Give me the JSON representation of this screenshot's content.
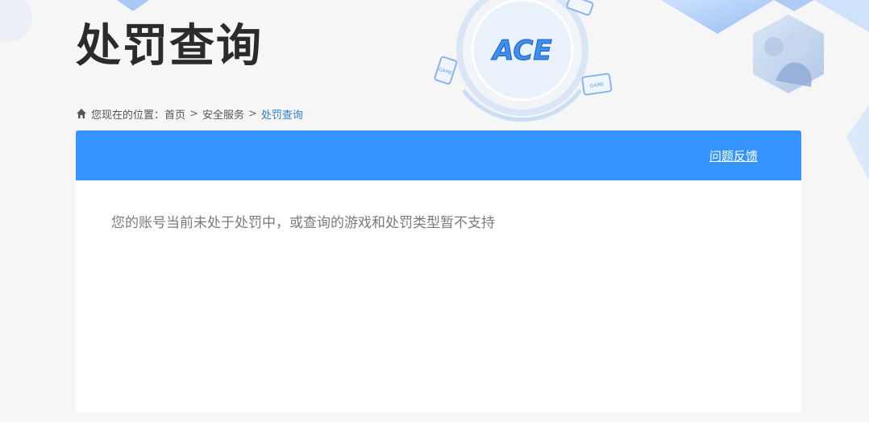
{
  "page": {
    "title": "处罚查询"
  },
  "breadcrumb": {
    "prefix": "您现在的位置：",
    "items": [
      "首页",
      "安全服务"
    ],
    "separator": ">",
    "current": "处罚查询"
  },
  "banner": {
    "feedback_label": "问题反馈",
    "color": "#3595ff"
  },
  "result": {
    "message": "您的账号当前未处于处罚中，或查询的游戏和处罚类型暂不支持"
  },
  "decor": {
    "logo_text": "ACE",
    "badge_text": "GAME"
  },
  "icons": {
    "home": "home-icon"
  }
}
